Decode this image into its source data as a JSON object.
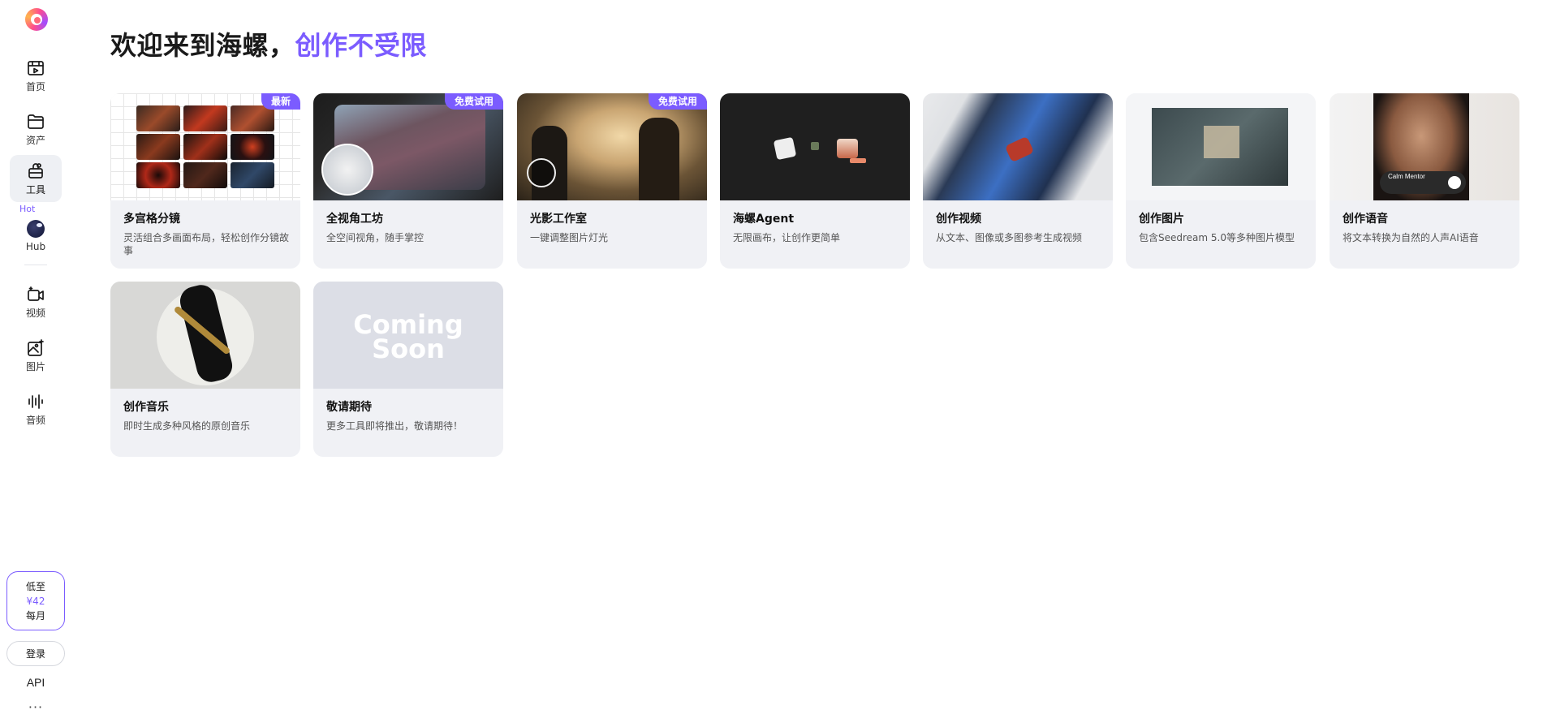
{
  "sidebar": {
    "items": [
      {
        "label": "首页",
        "icon": "home-icon"
      },
      {
        "label": "资产",
        "icon": "folder-icon"
      },
      {
        "label": "工具",
        "icon": "toolbox-icon"
      },
      {
        "label": "Hub",
        "icon": "hub-avatar-icon"
      },
      {
        "label": "视频",
        "icon": "video-icon"
      },
      {
        "label": "图片",
        "icon": "image-icon"
      },
      {
        "label": "音频",
        "icon": "audio-icon"
      }
    ],
    "hot_tag": "Hot",
    "promo": {
      "line1": "低至",
      "price": "¥42",
      "line3": "每月"
    },
    "login_label": "登录",
    "api_label": "API",
    "more_label": "···"
  },
  "header": {
    "title_main": "欢迎来到海螺，",
    "title_accent": "创作不受限"
  },
  "cards": [
    {
      "title": "多宫格分镜",
      "desc": "灵活组合多画面布局，轻松创作分镜故事",
      "badge": "最新"
    },
    {
      "title": "全视角工坊",
      "desc": "全空间视角，随手掌控",
      "badge": "免费试用"
    },
    {
      "title": "光影工作室",
      "desc": "一键调整图片灯光",
      "badge": "免费试用"
    },
    {
      "title": "海螺Agent",
      "desc": "无限画布，让创作更简单"
    },
    {
      "title": "创作视频",
      "desc": "从文本、图像或多图参考生成视频"
    },
    {
      "title": "创作图片",
      "desc": "包含Seedream 5.0等多种图片模型"
    },
    {
      "title": "创作语音",
      "desc": "将文本转换为自然的人声AI语音",
      "thumb_text": "Calm Mentor"
    },
    {
      "title": "创作音乐",
      "desc": "即时生成多种风格的原创音乐"
    },
    {
      "title": "敬请期待",
      "desc": "更多工具即将推出，敬请期待！",
      "thumb_text_1": "Coming",
      "thumb_text_2": "Soon"
    }
  ],
  "colors": {
    "accent": "#7b5cff",
    "card_bg": "#f0f1f5"
  }
}
